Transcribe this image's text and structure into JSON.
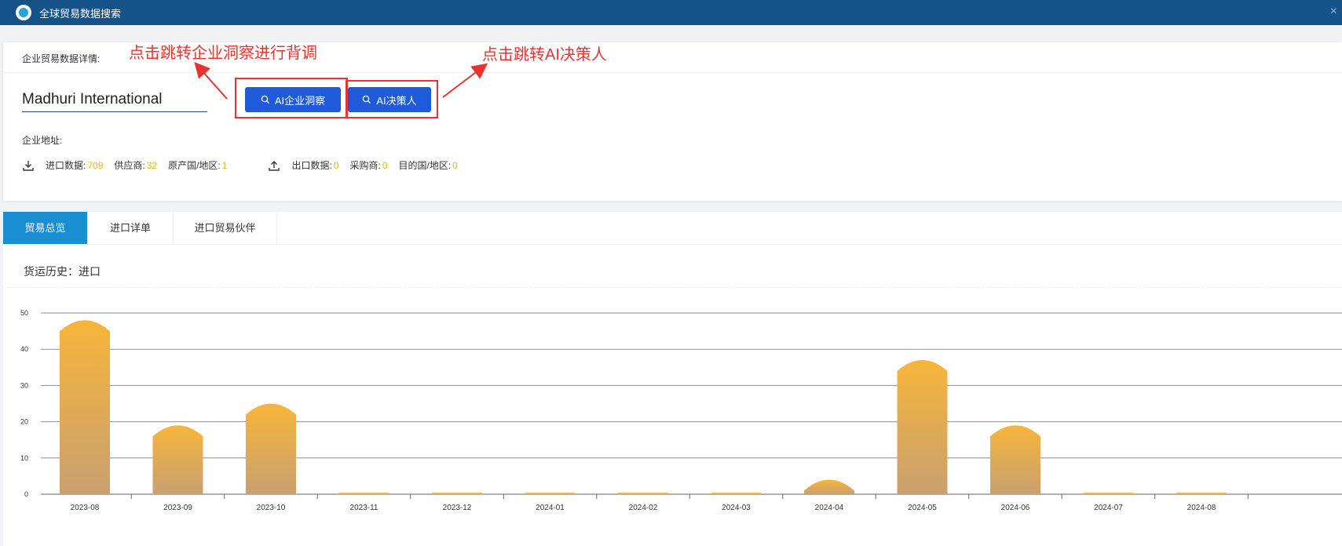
{
  "window": {
    "title": "全球贸易数据搜索",
    "close": "×"
  },
  "details": {
    "label": "企业贸易数据详情:",
    "company_name": "Madhuri International",
    "button_insight": "AI企业洞察",
    "button_decision": "AI决策人",
    "annotation_insight": "点击跳转企业洞察进行背调",
    "annotation_decision": "点击跳转AI决策人",
    "address_label": "企业地址:",
    "import": {
      "data_label": "进口数据:",
      "data_value": "709",
      "supplier_label": "供应商:",
      "supplier_value": "32",
      "origin_label": "原产国/地区:",
      "origin_value": "1"
    },
    "export": {
      "data_label": "出口数据:",
      "data_value": "0",
      "buyer_label": "采购商:",
      "buyer_value": "0",
      "dest_label": "目的国/地区:",
      "dest_value": "0"
    }
  },
  "tabs": [
    "贸易总览",
    "进口详单",
    "进口贸易伙伴"
  ],
  "history_label": "货运历史：进口",
  "colors": {
    "accent": "#1f5bd9",
    "annotation": "#e8332e",
    "bar_top": "#f7b53a",
    "bar_bottom": "#c9a070",
    "value": "#f0b30c"
  },
  "chart_data": {
    "type": "bar",
    "categories": [
      "2023-08",
      "2023-09",
      "2023-10",
      "2023-11",
      "2023-12",
      "2024-01",
      "2024-02",
      "2024-03",
      "2024-04",
      "2024-05",
      "2024-06",
      "2024-07",
      "2024-08"
    ],
    "values": [
      48,
      19,
      25,
      0,
      0,
      0,
      0,
      0,
      4,
      37,
      19,
      0,
      0
    ],
    "y_ticks": [
      0,
      10,
      20,
      30,
      40,
      50
    ],
    "ylim": [
      0,
      50
    ],
    "grid": true
  }
}
